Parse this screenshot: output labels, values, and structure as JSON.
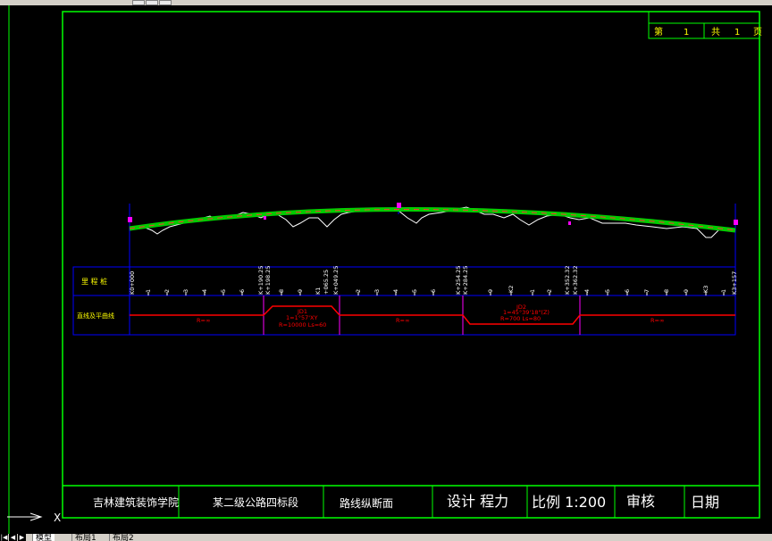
{
  "sheet_counter": {
    "cell1_label": "第",
    "cell1_value": "1",
    "cell2_label": "共",
    "cell2_value": "1",
    "cell2_suffix": "页"
  },
  "table_rows": {
    "row1_label": "里 程 桩",
    "row2_label": "直线及平曲线"
  },
  "stations": {
    "edge_left": "K0+000",
    "labels_a": [
      "1",
      "2",
      "3",
      "4",
      "5",
      "6"
    ],
    "mark_a": [
      "K+190.25",
      "K+198.25"
    ],
    "labels_b": [
      "8",
      "9"
    ],
    "mark_b": [
      "K1",
      "+065.25",
      "K+049.25"
    ],
    "labels_c": [
      "2",
      "3",
      "4",
      "5",
      "6"
    ],
    "mark_c": [
      "K+254.25",
      "K+284.25"
    ],
    "labels_d": [
      "9",
      "K2",
      "1",
      "2"
    ],
    "mark_d": [
      "K+352.32",
      "K+362.32"
    ],
    "labels_e": [
      "4",
      "5",
      "6",
      "7",
      "8",
      "9",
      "K3",
      "1"
    ],
    "edge_right": "K3+157"
  },
  "curve_labels": {
    "straight_1": "R=∞",
    "curve_1": {
      "jd": "JD1",
      "angle": "1=1°57'XY",
      "params": "R=10000  Ls=60"
    },
    "straight_2": "R=∞",
    "curve_2": {
      "jd": "JD2",
      "angle": "1=45°39'18\"(Z)",
      "params": "R=700  Ls=80"
    },
    "straight_3": "R=∞"
  },
  "title_block": {
    "school": "吉林建筑装饰学院",
    "project": "某二级公路四标段",
    "drawing": "路线纵断面",
    "design": "设计 程力",
    "scale": "比例 1:200",
    "review": "审核",
    "date": "日期"
  },
  "ucs": {
    "x_label": "X"
  },
  "tabs": [
    "模型",
    "布局1",
    "布局2"
  ],
  "colors": {
    "frame": "#00ff00",
    "table": "#0000ff",
    "text": "#ffff00",
    "design_line": "#00ff00",
    "ground_line": "#ffffff",
    "curve": "#ff0000",
    "marker": "#ff00ff"
  }
}
